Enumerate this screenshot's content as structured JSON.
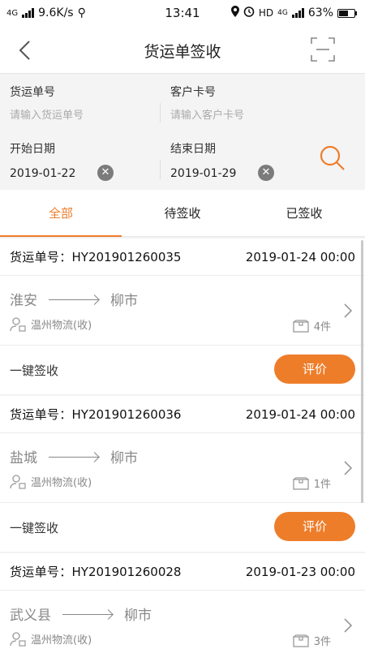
{
  "status_bar": {
    "network": "4G",
    "speed": "9.6K/s",
    "time": "13:41",
    "hd": "HD",
    "net2": "4G",
    "battery": "63%"
  },
  "navbar": {
    "title": "货运单签收"
  },
  "filter": {
    "waybill_label": "货运单号",
    "waybill_placeholder": "请输入货运单号",
    "card_label": "客户卡号",
    "card_placeholder": "请输入客户卡号",
    "start_label": "开始日期",
    "start_value": "2019-01-22",
    "end_label": "结束日期",
    "end_value": "2019-01-29"
  },
  "tabs": [
    {
      "label": "全部"
    },
    {
      "label": "待签收"
    },
    {
      "label": "已签收"
    }
  ],
  "orders": [
    {
      "no_label": "货运单号：",
      "no": "HY201901260035",
      "datetime": "2019-01-24 00:00",
      "from": "淮安",
      "to": "柳市",
      "company": "温州物流(收)",
      "count": "4件",
      "quick_sign": "一键签收",
      "rate": "评价"
    },
    {
      "no_label": "货运单号：",
      "no": "HY201901260036",
      "datetime": "2019-01-24 00:00",
      "from": "盐城",
      "to": "柳市",
      "company": "温州物流(收)",
      "count": "1件",
      "quick_sign": "一键签收",
      "rate": "评价"
    },
    {
      "no_label": "货运单号：",
      "no": "HY201901260028",
      "datetime": "2019-01-23 00:00",
      "from": "武义县",
      "to": "柳市",
      "company": "温州物流(收)",
      "count": "3件"
    }
  ],
  "colors": {
    "accent": "#ee7d2a",
    "muted": "#888888"
  }
}
